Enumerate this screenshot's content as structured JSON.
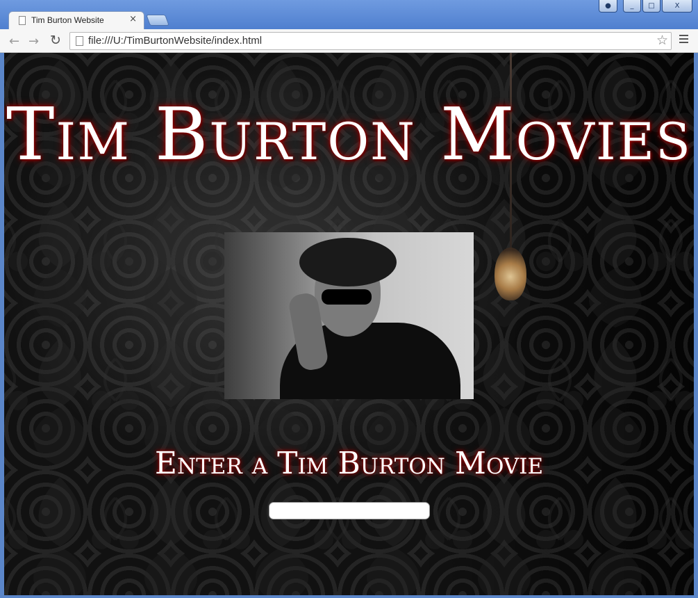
{
  "browser": {
    "tab_title": "Tim Burton Website",
    "tab_close": "×",
    "url": "file:///U:/TimBurtonWebsite/index.html",
    "window_controls": {
      "minimize": "_",
      "maximize": "□",
      "close": "X"
    }
  },
  "page": {
    "title": "Tim Burton Movies",
    "subtitle": "Enter a Tim Burton Movie",
    "input_value": ""
  },
  "icons": {
    "back": "arrow-left-icon",
    "forward": "arrow-right-icon",
    "reload": "reload-icon",
    "star": "star-icon",
    "menu": "menu-icon",
    "user": "user-icon"
  },
  "colors": {
    "title_glow": "#b10000",
    "chrome_blue": "#5b86c9"
  }
}
